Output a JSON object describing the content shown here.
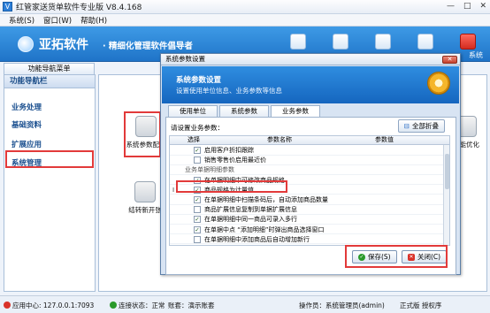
{
  "window": {
    "title": "红管家送货单软件专业版 V8.4.168",
    "app_icon": "V",
    "minimize": "—",
    "maximize": "□",
    "close": "✕"
  },
  "menu": [
    "系统(S)",
    "窗口(W)",
    "帮助(H)"
  ],
  "banner": {
    "brand": "亚拓软件",
    "slogan": "· 精细化管理软件倡导者",
    "sys_label": "系统"
  },
  "left": {
    "tab": "功能导航菜单",
    "header": "功能导航栏",
    "items": [
      "业务处理",
      "基础资料",
      "扩展应用",
      "系统管理"
    ]
  },
  "tiles": [
    {
      "label": "系统参数配置"
    },
    {
      "label": "结转新开张"
    },
    {
      "label": "功能优化"
    }
  ],
  "dialog": {
    "title": "系统参数设置",
    "close": "✕",
    "head_title": "系统参数设置",
    "head_sub": "设置使用单位信息、业务参数等信息",
    "tabs": [
      "使用单位",
      "系统参数",
      "业务参数"
    ],
    "active_tab": 2,
    "prompt": "请设置业务参数：",
    "expand_button": "全部折叠",
    "columns": {
      "select": "选择",
      "name": "参数名称",
      "value": "参数值"
    },
    "rows": [
      {
        "type": "item",
        "checked": true,
        "name": "启用客户折扣跟踪"
      },
      {
        "type": "item",
        "checked": false,
        "name": "销售零售价启用最近价"
      },
      {
        "type": "group",
        "name": "业务单据明细参数"
      },
      {
        "type": "item",
        "checked": true,
        "name": "在单据明细中可修改商品规格"
      },
      {
        "type": "item",
        "checked": true,
        "name": "商品规格为计量值",
        "current": true,
        "marker": "I"
      },
      {
        "type": "item",
        "checked": true,
        "name": "在单据明细中扫描条码后，自动添加商品数量"
      },
      {
        "type": "item",
        "checked": false,
        "name": "商品扩展信息复制到单据扩展信息"
      },
      {
        "type": "item",
        "checked": true,
        "name": "在单据明细中同一商品可录入多行"
      },
      {
        "type": "item",
        "checked": true,
        "name": "在单据中点 “添加明细”时弹出商品选择窗口"
      },
      {
        "type": "item",
        "checked": false,
        "name": "在单据明细中添加商品后自动增加新行"
      }
    ],
    "save_button": "保存(S)",
    "close_button": "关闭(C)"
  },
  "status": {
    "app_center": "应用中心: 127.0.0.1:7093",
    "connection": "连接状态：正常",
    "account": "账套：演示账套",
    "operator": "操作员：系统管理员(admin)",
    "edition": "正式版 授权序"
  },
  "colors": {
    "accent": "#1f74c8",
    "highlight_box": "#e23a3a",
    "ok_green": "#2a9a2a",
    "close_red": "#d9332a"
  }
}
